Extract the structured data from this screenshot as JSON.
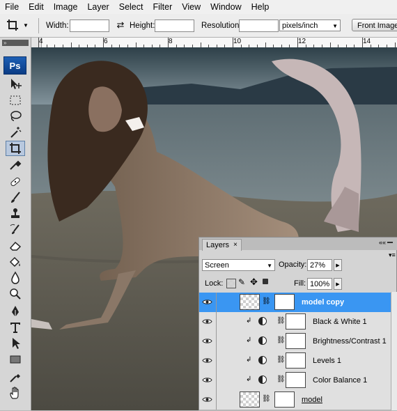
{
  "menu": [
    "File",
    "Edit",
    "Image",
    "Layer",
    "Select",
    "Filter",
    "View",
    "Window",
    "Help"
  ],
  "options": {
    "width_label": "Width:",
    "height_label": "Height:",
    "resolution_label": "Resolution:",
    "resolution_unit": "pixels/inch",
    "front_image_label": "Front Image"
  },
  "ruler": {
    "labels": [
      "4",
      "6",
      "8",
      "10",
      "12",
      "14"
    ]
  },
  "toolbox": {
    "logo": "Ps"
  },
  "layers_panel": {
    "tab_label": "Layers",
    "blend_mode": "Screen",
    "opacity_label": "Opacity:",
    "opacity_value": "27%",
    "lock_label": "Lock:",
    "fill_label": "Fill:",
    "fill_value": "100%",
    "layers": [
      {
        "name": "model copy",
        "kind": "pixel",
        "selected": true
      },
      {
        "name": "Black & White 1",
        "kind": "adjustment",
        "selected": false
      },
      {
        "name": "Brightness/Contrast 1",
        "kind": "adjustment",
        "selected": false
      },
      {
        "name": "Levels 1",
        "kind": "adjustment",
        "selected": false
      },
      {
        "name": "Color Balance 1",
        "kind": "adjustment",
        "selected": false
      },
      {
        "name": "model",
        "kind": "pixel",
        "selected": false
      }
    ]
  },
  "colors": {
    "selection": "#3a96f2",
    "ps_logo": "#0b3c85"
  }
}
